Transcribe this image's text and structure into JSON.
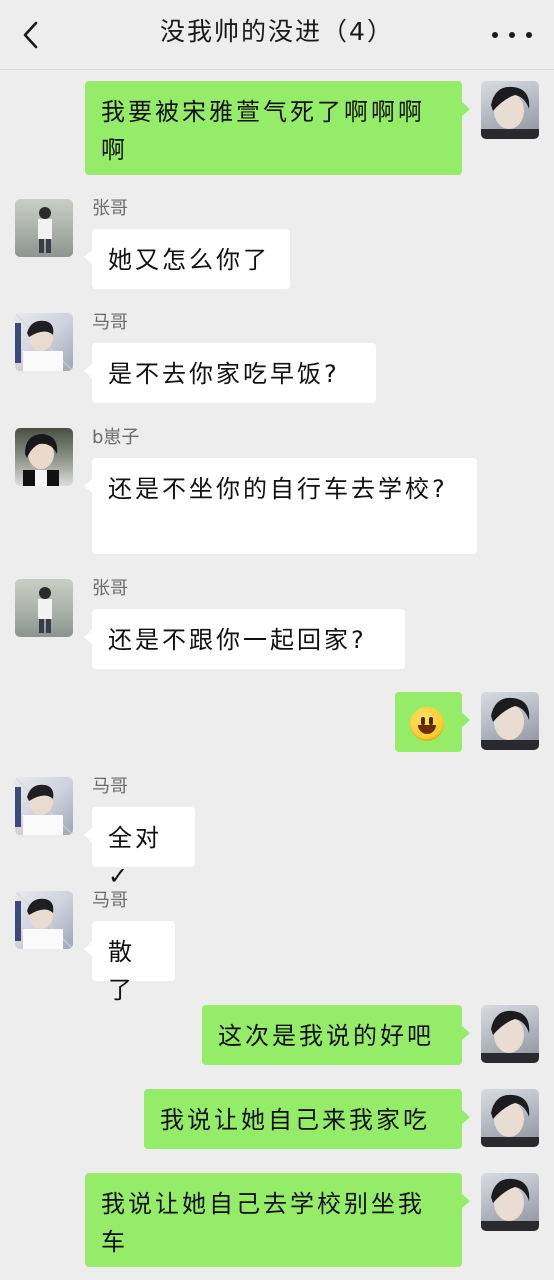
{
  "header": {
    "title": "没我帅的没进（4）",
    "back_icon": "chevron-left-icon",
    "more_icon": "more-dots-icon"
  },
  "messages": [
    {
      "side": "right",
      "text": "我要被宋雅萱气死了啊啊啊啊"
    },
    {
      "side": "left",
      "sender": "张哥",
      "text": "她又怎么你了"
    },
    {
      "side": "left",
      "sender": "马哥",
      "text": "是不去你家吃早饭?"
    },
    {
      "side": "left",
      "sender": "b崽子",
      "text": "还是不坐你的自行车去学校?"
    },
    {
      "side": "left",
      "sender": "张哥",
      "text": "还是不跟你一起回家?"
    },
    {
      "side": "right",
      "emoji": "grinning-face-emoji"
    },
    {
      "side": "left",
      "sender": "马哥",
      "text": "全对✓"
    },
    {
      "side": "left",
      "sender": "马哥",
      "text": "散了"
    },
    {
      "side": "right",
      "text": "这次是我说的好吧"
    },
    {
      "side": "right",
      "text": "我说让她自己来我家吃"
    },
    {
      "side": "right",
      "text": "我说让她自己去学校别坐我车"
    }
  ],
  "colors": {
    "background": "#ededed",
    "own_bubble": "#95ec69",
    "other_bubble": "#ffffff"
  }
}
